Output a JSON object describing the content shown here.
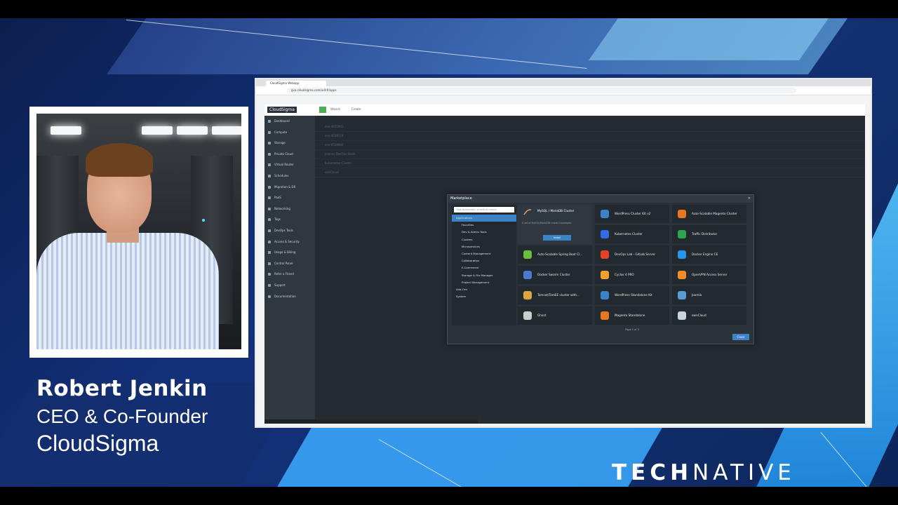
{
  "caption": {
    "name": "Robert Jenkin",
    "role": "CEO & Co-Founder",
    "company": "CloudSigma"
  },
  "brand": {
    "bold": "TECH",
    "rest": "NATIVE"
  },
  "browser": {
    "tab_title": "CloudSigma Webapp",
    "url": "gva.cloudsigma.com/ui4/#/apps"
  },
  "app": {
    "logo": "CloudSigma",
    "toolbar": [
      "Wizard",
      "Create"
    ],
    "sidebar": [
      "Dashboard",
      "Compute",
      "Storage",
      "Private Cloud",
      "Virtual Router",
      "Schedules",
      "Migration & DR",
      "PaaS",
      "Networking",
      "Tags",
      "DevOps Tools",
      "Access & Security",
      "Usage & Billing",
      "Control Panel",
      "Refer a Friend",
      "Support",
      "Documentation"
    ],
    "rows": [
      "env-4435893",
      "env-4038574",
      "env-8538984",
      "Jenkins DevOps Stack",
      "Kubernetes Cluster",
      "ownCloud"
    ]
  },
  "marketplace": {
    "title": "Marketplace",
    "search_placeholder": "Type application or add-on name",
    "tree": [
      {
        "label": "Applications",
        "level": 0,
        "selected": true
      },
      {
        "label": "Favorites",
        "level": 1
      },
      {
        "label": "Dev & Admin Tools",
        "level": 1
      },
      {
        "label": "Clusters",
        "level": 1
      },
      {
        "label": "Microservices",
        "level": 1
      },
      {
        "label": "Content Management",
        "level": 1
      },
      {
        "label": "Collaboration",
        "level": 1
      },
      {
        "label": "E-Commerce",
        "level": 1
      },
      {
        "label": "Storage & File Manager",
        "level": 1
      },
      {
        "label": "Project Management",
        "level": 1
      },
      {
        "label": "Add-Ons",
        "level": 0
      },
      {
        "label": "System",
        "level": 0
      }
    ],
    "featured": {
      "title": "MySQL / MariaDB Cluster",
      "desc": "A set of MySQL/MariaDB cluster topologies",
      "install": "Install"
    },
    "apps": [
      "WordPress Cluster Kit v2",
      "Auto-Scalable Magento Cluster",
      "Kubernetes Cluster",
      "Traffic Distributor",
      "Auto-Scalable Spring Boot Cl...",
      "DevOps Lab - GitLab Server",
      "Docker Engine CE",
      "Docker Swarm Cluster",
      "Cyclos 4 PRO",
      "OpenVPN Access Server",
      "Tomcat/TomEE cluster with...",
      "WordPress Standalone Kit",
      "Joomla",
      "Ghost",
      "Magento Standalone",
      "ownCloud"
    ],
    "pager": "Page 1 of 3",
    "close": "Close"
  }
}
